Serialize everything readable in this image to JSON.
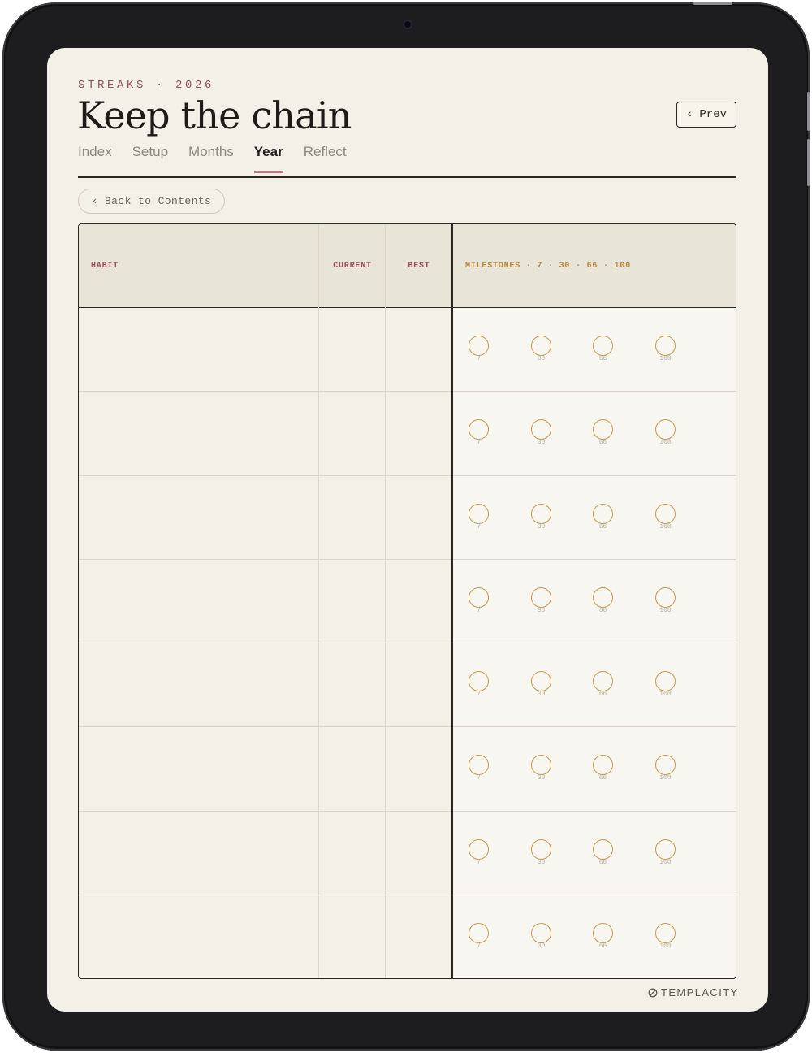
{
  "header": {
    "eyebrow": "STREAKS · 2026",
    "title": "Keep the chain",
    "prev_label": "Prev"
  },
  "tabs": [
    {
      "label": "Index",
      "active": false
    },
    {
      "label": "Setup",
      "active": false
    },
    {
      "label": "Months",
      "active": false
    },
    {
      "label": "Year",
      "active": true
    },
    {
      "label": "Reflect",
      "active": false
    }
  ],
  "back_label": "Back to Contents",
  "table": {
    "columns": {
      "habit": "HABIT",
      "current": "CURRENT",
      "best": "BEST",
      "milestones": "MILESTONES · 7 · 30 · 66 · 100"
    },
    "milestones": [
      "7",
      "30",
      "66",
      "100"
    ],
    "row_count": 8
  },
  "brand": "TEMPLACITY",
  "colors": {
    "accent": "#9b4f5a",
    "gold": "#c79a4e",
    "paper": "#f3f0e8",
    "ink": "#1e1c19"
  }
}
